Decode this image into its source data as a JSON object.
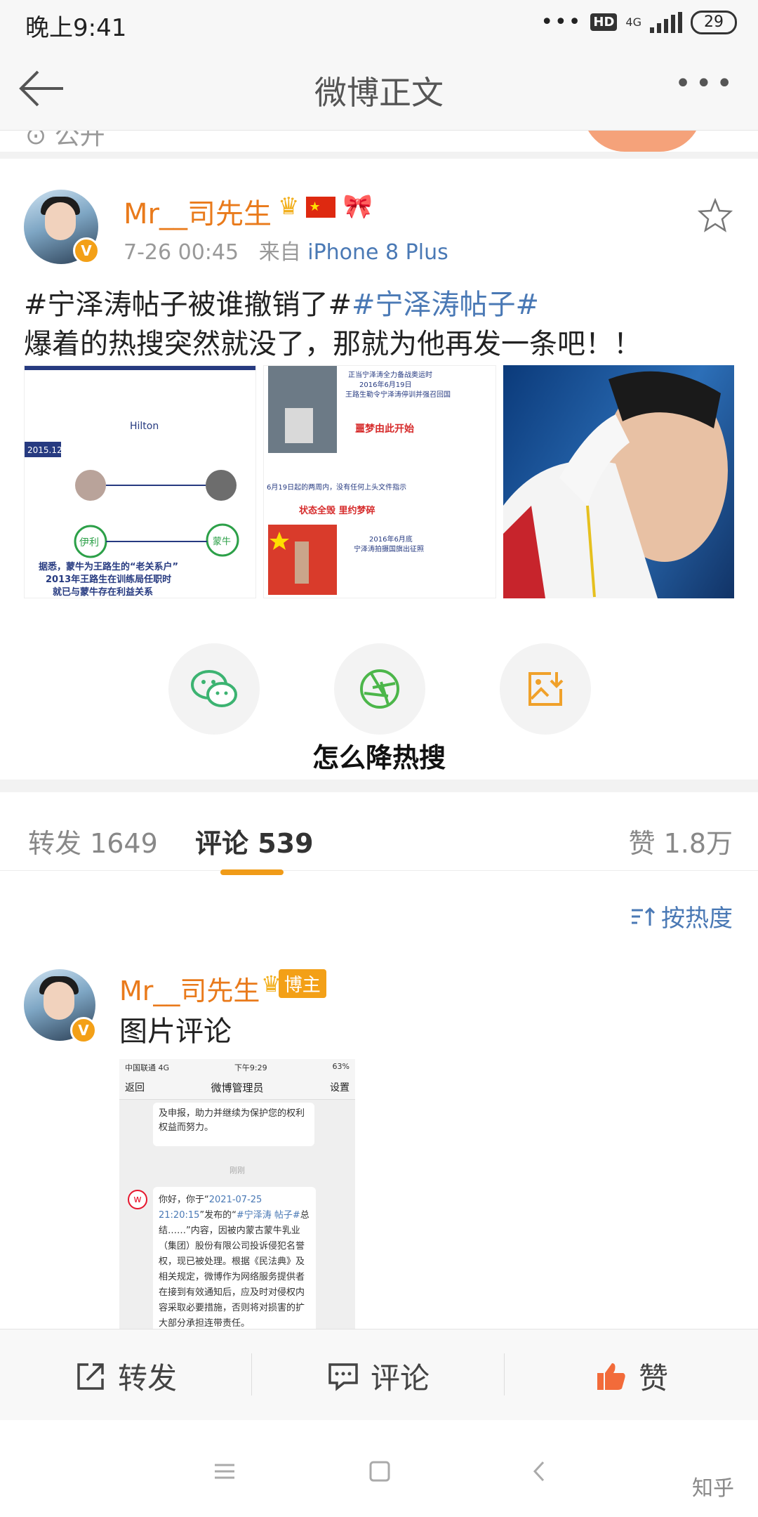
{
  "status_bar": {
    "time": "晚上9:41",
    "signal_dots": "•••",
    "hd": "HD",
    "network": "4G",
    "battery": "29"
  },
  "nav": {
    "title": "微博正文",
    "back_icon": "back-arrow-icon",
    "more_icon": "more-icon"
  },
  "prev_item": {
    "visibility": "公开"
  },
  "post": {
    "author": "Mr__司先生",
    "time": "7-26 00:45",
    "source_prefix": "来自",
    "source_device": "iPhone 8 Plus",
    "hashtag_plain": "#宁泽涛帖子被谁撤销了#",
    "hashtag_link": "#宁泽涛帖子#",
    "body": "爆着的热搜突然就没了，那就为他再发一条吧！！",
    "images": [
      {
        "label_year": "2015.12",
        "brands": "Hilton",
        "caption_1": "据悉，蒙牛为王路生的“老关系户”",
        "caption_2": "2013年王路生在训练局任职时",
        "caption_3": "就已与蒙牛存在利益关系",
        "logo": "伊利",
        "logo2": "蒙牛"
      },
      {
        "line_1": "正当宁泽涛全力备战奥运时",
        "line_2": "2016年6月19日",
        "line_3": "王路生勒令宁泽涛停训并强召回国",
        "highlight_1": "噩梦由此开始",
        "line_4": "6月19日起的两周内，没有任何上头文件指示",
        "highlight_2": "状态全毁 里约梦碎",
        "line_5": "2016年6月底",
        "line_6": "宁泽涛拍摄国旗出征照"
      },
      {
        "alt": "salute"
      }
    ]
  },
  "share": {
    "wechat_icon": "wechat-icon",
    "moments_icon": "moments-icon",
    "save_icon": "save-image-icon",
    "caption": "怎么降热搜"
  },
  "tabs": {
    "repost": "转发 1649",
    "comment": "评论 539",
    "like": "赞 1.8万"
  },
  "sort": {
    "label": "按热度"
  },
  "comment": {
    "author": "Mr__司先生",
    "host_tag": "博主",
    "text": "图片评论",
    "screenshot": {
      "carrier": "中国联通 4G",
      "time": "下午9:29",
      "battery": "63%",
      "back": "返回",
      "title": "微博管理员",
      "settings": "设置",
      "bubble_1": "及申报，助力并继续为保护您的权利权益而努力。",
      "separator": "刚刚",
      "msg_prefix": "你好，你于“",
      "msg_date": "2021-07-25 21:20:15",
      "msg_mid": "”发布的“",
      "msg_tag": "#宁泽涛 帖子#",
      "msg_rest": "总结……”内容，因被内蒙古蒙牛乳业（集团）股份有限公司投诉侵犯名誉权，现已被处理。根据《民法典》及相关规定，微博作为网络服务提供者在接到有效通知后，应及时对侵权内容采取必要措施，否则将对损害的扩大部分承担连带责任。"
    }
  },
  "actions": {
    "repost": "转发",
    "comment": "评论",
    "like": "赞"
  },
  "watermark": "知乎"
}
